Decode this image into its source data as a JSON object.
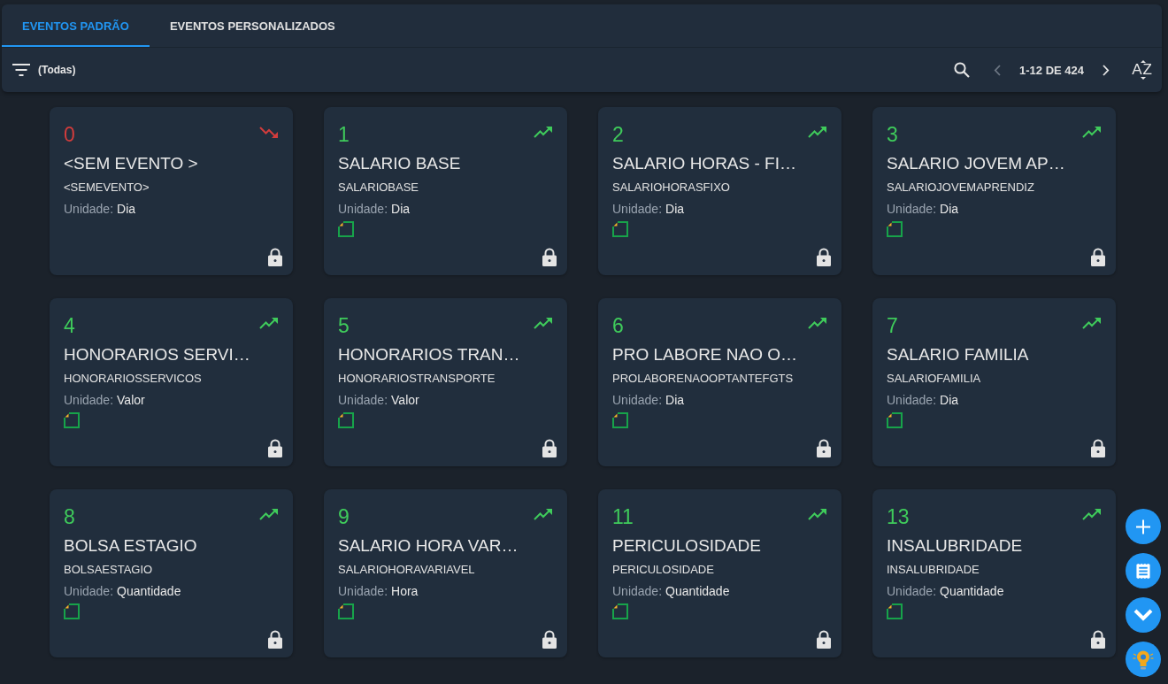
{
  "tabs": [
    {
      "label": "EVENTOS PADRÃO",
      "selected": true
    },
    {
      "label": "EVENTOS PERSONALIZADOS",
      "selected": false
    }
  ],
  "toolbar": {
    "filter": "(Todas)",
    "pagination": {
      "label": "1-12 DE 424",
      "previous_disabled": true,
      "next_disabled": false
    },
    "sort": "AZ"
  },
  "cards": [
    {
      "number": "0",
      "kind": "down",
      "title": "<SEM EVENTO >",
      "code": "<SEMEVENTO>",
      "unit_label": "Unidade:",
      "unit": "Dia",
      "document": false,
      "locked": true
    },
    {
      "number": "1",
      "kind": "up",
      "title": "SALARIO BASE",
      "code": "SALARIOBASE",
      "unit_label": "Unidade:",
      "unit": "Dia",
      "document": true,
      "locked": true
    },
    {
      "number": "2",
      "kind": "up",
      "title": "SALARIO HORAS - FI…",
      "code": "SALARIOHORASFIXO",
      "unit_label": "Unidade:",
      "unit": "Dia",
      "document": true,
      "locked": true
    },
    {
      "number": "3",
      "kind": "up",
      "title": "SALARIO JOVEM AP…",
      "code": "SALARIOJOVEMAPRENDIZ",
      "unit_label": "Unidade:",
      "unit": "Dia",
      "document": true,
      "locked": true
    },
    {
      "number": "4",
      "kind": "up",
      "title": "HONORARIOS SERVI…",
      "code": "HONORARIOSSERVICOS",
      "unit_label": "Unidade:",
      "unit": "Valor",
      "document": true,
      "locked": true
    },
    {
      "number": "5",
      "kind": "up",
      "title": "HONORARIOS TRAN…",
      "code": "HONORARIOSTRANSPORTE",
      "unit_label": "Unidade:",
      "unit": "Valor",
      "document": true,
      "locked": true
    },
    {
      "number": "6",
      "kind": "up",
      "title": "PRO LABORE NAO O…",
      "code": "PROLABORENAOOPTANTEFGTS",
      "unit_label": "Unidade:",
      "unit": "Dia",
      "document": true,
      "locked": true
    },
    {
      "number": "7",
      "kind": "up",
      "title": "SALARIO FAMILIA",
      "code": "SALARIOFAMILIA",
      "unit_label": "Unidade:",
      "unit": "Dia",
      "document": true,
      "locked": true
    },
    {
      "number": "8",
      "kind": "up",
      "title": "BOLSA ESTAGIO",
      "code": "BOLSAESTAGIO",
      "unit_label": "Unidade:",
      "unit": "Quantidade",
      "document": true,
      "locked": true
    },
    {
      "number": "9",
      "kind": "up",
      "title": "SALARIO HORA VAR…",
      "code": "SALARIOHORAVARIAVEL",
      "unit_label": "Unidade:",
      "unit": "Hora",
      "document": true,
      "locked": true
    },
    {
      "number": "11",
      "kind": "up",
      "title": "PERICULOSIDADE",
      "code": "PERICULOSIDADE",
      "unit_label": "Unidade:",
      "unit": "Quantidade",
      "document": true,
      "locked": true
    },
    {
      "number": "13",
      "kind": "up",
      "title": "INSALUBRIDADE",
      "code": "INSALUBRIDADE",
      "unit_label": "Unidade:",
      "unit": "Quantidade",
      "document": true,
      "locked": true
    }
  ]
}
